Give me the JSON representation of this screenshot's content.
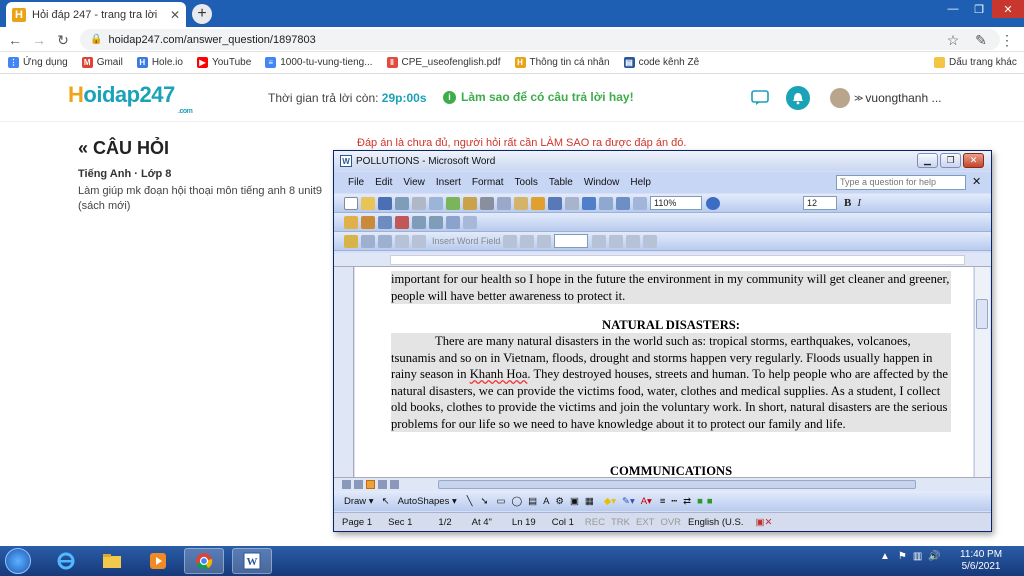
{
  "browser": {
    "tab_title": "Hỏi đáp 247 - trang tra lời",
    "url": "hoidap247.com/answer_question/1897803",
    "bookmarks": [
      {
        "label": "Ứng dụng",
        "icon": "apps-grid-icon",
        "color": "#4285f4"
      },
      {
        "label": "Gmail",
        "icon": "gmail-icon",
        "color": "#db4437"
      },
      {
        "label": "Hole.io",
        "icon": "holeio-icon",
        "color": "#3b7be0"
      },
      {
        "label": "YouTube",
        "icon": "youtube-icon",
        "color": "#ff0000"
      },
      {
        "label": "1000-tu-vung-tieng...",
        "icon": "doc-icon",
        "color": "#4285f4"
      },
      {
        "label": "CPE_useofenglish.pdf",
        "icon": "pdf-icon",
        "color": "#e04a3f"
      },
      {
        "label": "Thông tin cá nhân",
        "icon": "hoidap-icon",
        "color": "#e8a317"
      },
      {
        "label": "code kênh Zê",
        "icon": "sheet-icon",
        "color": "#2b579a"
      }
    ],
    "bookmarks_other": "Dấu trang khác"
  },
  "site": {
    "logo_h": "H",
    "logo_rest": "oidap247",
    "logo_com": ".com",
    "timer_label": "Thời gian trả lời còn:",
    "timer_value": "29p:00s",
    "howto": "Làm sao để có câu trả lời hay!",
    "username": "vuongthanh ..."
  },
  "question": {
    "title": "CÂU HỎI",
    "subject": "Tiếng Anh · Lớp 8",
    "text": "Làm giúp mk đoạn hội thoại môn tiếng anh 8 unit9 (sách mới)",
    "note": "Đáp án là chưa đủ, người hỏi rất cần LÀM SAO ra được đáp án đó."
  },
  "word": {
    "title": "POLLUTIONS - Microsoft Word",
    "menu": [
      "File",
      "Edit",
      "View",
      "Insert",
      "Format",
      "Tools",
      "Table",
      "Window",
      "Help"
    ],
    "help_placeholder": "Type a question for help",
    "zoom": "110%",
    "font_size": "12",
    "insert_word_field": "Insert Word Field",
    "doc": {
      "line1": "important for our health so I hope in the future the environment in my community will get cleaner and greener, people will have better awareness to protect it.",
      "heading1": "NATURAL DISASTERS:",
      "para1_a": "There are many natural disasters in the world such as: tropical storms, earthquakes, volcanoes, tsunamis and so on in Vietnam, floods, drought and storms happen very regularly. Floods usually happen in rainy season in ",
      "para1_place": "Khanh Hoa",
      "para1_b": ". They destroyed houses, streets and human. To help people who are affected by the natural disasters, we can provide the victims food, water, clothes and medical supplies. As a student, I collect old books, clothes to provide the victims and join the voluntary work. In short, natural disasters are the serious problems for our life so we need to have knowledge about it to protect our family and life.",
      "heading2": "COMMUNICATIONS"
    },
    "draw_label": "Draw",
    "autoshapes_label": "AutoShapes",
    "status": {
      "page": "Page 1",
      "sec": "Sec 1",
      "pages": "1/2",
      "at": "At 4\"",
      "ln": "Ln 19",
      "col": "Col 1",
      "rec": "REC",
      "trk": "TRK",
      "ext": "EXT",
      "ovr": "OVR",
      "lang": "English (U.S."
    }
  },
  "taskbar": {
    "time": "11:40 PM",
    "date": "5/6/2021"
  },
  "colors": {
    "brand_teal": "#1aa2b7",
    "brand_orange": "#f2a31d",
    "green": "#3dad4a",
    "note_red": "#d0342c"
  }
}
